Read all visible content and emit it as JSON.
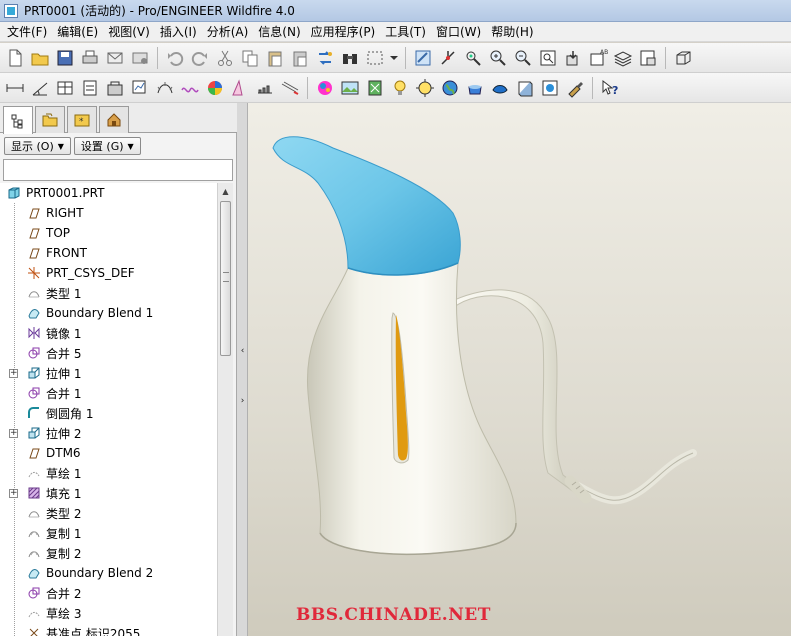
{
  "window": {
    "title": "PRT0001 (活动的) - Pro/ENGINEER Wildfire 4.0"
  },
  "menu": [
    "文件(F)",
    "编辑(E)",
    "视图(V)",
    "插入(I)",
    "分析(A)",
    "信息(N)",
    "应用程序(P)",
    "工具(T)",
    "窗口(W)",
    "帮助(H)"
  ],
  "toolbar1_icons": [
    "new-file-icon",
    "open-folder-icon",
    "save-icon",
    "print-icon",
    "send-mail-icon",
    "mail-icon",
    "undo-icon",
    "redo-icon",
    "cut-icon",
    "copy-icon",
    "paste-icon",
    "paste-special-icon",
    "regenerate-icon",
    "find-icon",
    "select-box-icon",
    "dropdown-arrow-icon",
    "repaint-icon",
    "spin-center-icon",
    "orient-icon",
    "zoom-in-icon",
    "zoom-out-icon",
    "refit-icon",
    "reorient-icon",
    "saved-views-icon",
    "layers-icon",
    "setup-icon",
    "datum-display-icon"
  ],
  "toolbar2_icons": [
    "measure-distance-icon",
    "measure-angle-icon",
    "table-icon",
    "calc-icon",
    "model-info-icon",
    "analysis-icon",
    "curvature-icon",
    "curve-icon",
    "draft-check-icon",
    "color-shade-icon",
    "graph-icon",
    "sweep-icon",
    "arrows-icon",
    "appearance-icon",
    "photo-render-icon",
    "flag-icon",
    "lightbulb-icon",
    "scene-icon",
    "globe-icon",
    "pot-icon",
    "texture-icon",
    "box-icon",
    "sphere-icon",
    "brush-icon",
    "whats-this-icon"
  ],
  "panel": {
    "tabs": [
      "model-tree-tab",
      "folder-tab",
      "favorites-tab",
      "connections-tab"
    ],
    "show_button": "显示 (O)",
    "settings_button": "设置 (G)",
    "filter_value": ""
  },
  "tree": {
    "root": "PRT0001.PRT",
    "items": [
      {
        "label": "RIGHT",
        "icon": "datum-plane-icon",
        "expandable": false
      },
      {
        "label": "TOP",
        "icon": "datum-plane-icon",
        "expandable": false
      },
      {
        "label": "FRONT",
        "icon": "datum-plane-icon",
        "expandable": false
      },
      {
        "label": "PRT_CSYS_DEF",
        "icon": "csys-icon",
        "expandable": false
      },
      {
        "label": "类型 1",
        "icon": "style-icon",
        "expandable": false
      },
      {
        "label": "Boundary Blend 1",
        "icon": "boundary-blend-icon",
        "expandable": false
      },
      {
        "label": "镜像 1",
        "icon": "mirror-icon",
        "expandable": false
      },
      {
        "label": "合并 5",
        "icon": "merge-icon",
        "expandable": false
      },
      {
        "label": "拉伸 1",
        "icon": "extrude-icon",
        "expandable": true
      },
      {
        "label": "合并 1",
        "icon": "merge-icon",
        "expandable": false
      },
      {
        "label": "倒圆角 1",
        "icon": "round-icon",
        "expandable": false
      },
      {
        "label": "拉伸 2",
        "icon": "extrude-icon",
        "expandable": true
      },
      {
        "label": "DTM6",
        "icon": "datum-plane-icon",
        "expandable": false
      },
      {
        "label": "草绘 1",
        "icon": "sketch-icon",
        "expandable": false
      },
      {
        "label": "填充 1",
        "icon": "fill-icon",
        "expandable": true
      },
      {
        "label": "类型 2",
        "icon": "style-icon",
        "expandable": false
      },
      {
        "label": "复制 1",
        "icon": "copy-surface-icon",
        "expandable": false
      },
      {
        "label": "复制 2",
        "icon": "copy-surface-icon",
        "expandable": false
      },
      {
        "label": "Boundary Blend 2",
        "icon": "boundary-blend-icon",
        "expandable": false
      },
      {
        "label": "合并 2",
        "icon": "merge-icon",
        "expandable": false
      },
      {
        "label": "草绘 3",
        "icon": "sketch-icon",
        "expandable": false
      },
      {
        "label": "基准点 标识2055",
        "icon": "datum-point-icon",
        "expandable": false
      }
    ]
  },
  "viewport": {
    "watermark": "BBS.CHINADE.NET",
    "colors": {
      "spout": "#6cc6e8",
      "body": "#f2f1e8",
      "window": "#e09a10",
      "watermark": "#e0283a"
    }
  }
}
